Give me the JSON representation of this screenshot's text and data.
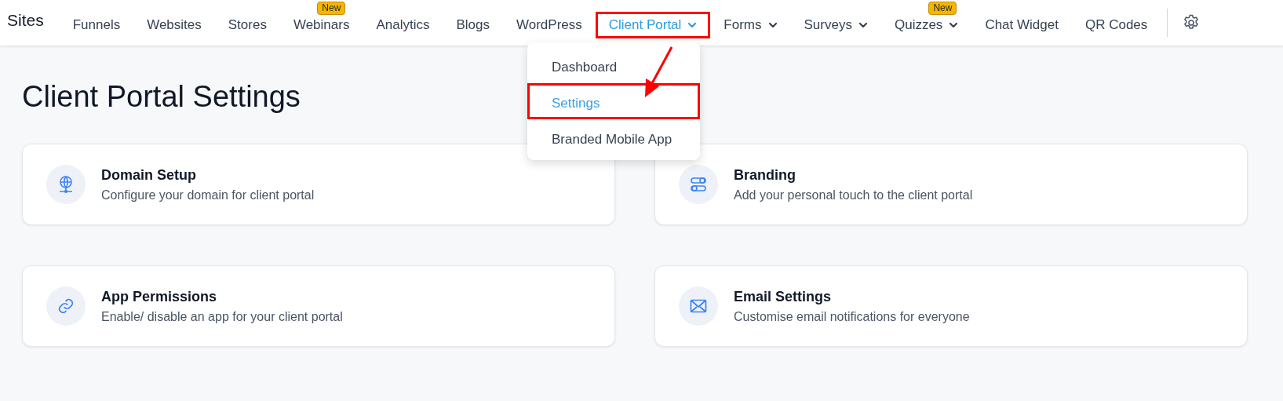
{
  "brand": "Sites",
  "nav": [
    {
      "label": "Funnels",
      "selected": false,
      "dropdown": false,
      "highlighted": false
    },
    {
      "label": "Websites",
      "selected": false,
      "dropdown": false,
      "highlighted": false
    },
    {
      "label": "Stores",
      "selected": false,
      "dropdown": false,
      "highlighted": false
    },
    {
      "label": "Webinars",
      "selected": false,
      "dropdown": false,
      "highlighted": false,
      "badge": "New"
    },
    {
      "label": "Analytics",
      "selected": false,
      "dropdown": false,
      "highlighted": false
    },
    {
      "label": "Blogs",
      "selected": false,
      "dropdown": false,
      "highlighted": false
    },
    {
      "label": "WordPress",
      "selected": false,
      "dropdown": false,
      "highlighted": false
    },
    {
      "label": "Client Portal",
      "selected": true,
      "dropdown": true,
      "highlighted": true
    },
    {
      "label": "Forms",
      "selected": false,
      "dropdown": true,
      "highlighted": false
    },
    {
      "label": "Surveys",
      "selected": false,
      "dropdown": true,
      "highlighted": false
    },
    {
      "label": "Quizzes",
      "selected": false,
      "dropdown": true,
      "highlighted": false,
      "badge": "New"
    },
    {
      "label": "Chat Widget",
      "selected": false,
      "dropdown": false,
      "highlighted": false
    },
    {
      "label": "QR Codes",
      "selected": false,
      "dropdown": false,
      "highlighted": false
    }
  ],
  "menu": [
    {
      "label": "Dashboard",
      "selected": false,
      "highlighted": false
    },
    {
      "label": "Settings",
      "selected": true,
      "highlighted": true
    },
    {
      "label": "Branded Mobile App",
      "selected": false,
      "highlighted": false
    }
  ],
  "heading": "Client Portal Settings",
  "cards": [
    {
      "title": "Domain Setup",
      "description": "Configure your domain for client portal"
    },
    {
      "title": "Branding",
      "description": "Add your personal touch to the client portal"
    },
    {
      "title": "App Permissions",
      "description": "Enable/ disable an app for your client portal"
    },
    {
      "title": "Email Settings",
      "description": "Customise email notifications for everyone"
    }
  ]
}
